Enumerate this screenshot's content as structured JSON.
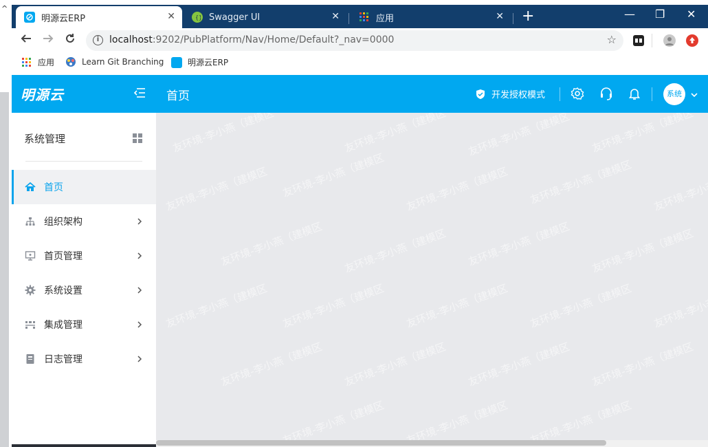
{
  "browser": {
    "tabs": [
      {
        "title": "明源云ERP",
        "close": "✕"
      },
      {
        "title": "Swagger UI",
        "close": "✕"
      },
      {
        "title": "应用",
        "close": "✕"
      }
    ],
    "new_tab": "+",
    "window_buttons": {
      "minimize": "—",
      "restore": "❐",
      "close": "✕"
    },
    "url_host": "localhost",
    "url_path": ":9202/PubPlatform/Nav/Home/Default?_nav=0000",
    "bookmarks": [
      "应用",
      "Learn Git Branching",
      "明源云ERP"
    ]
  },
  "header": {
    "logo": "明源云",
    "title": "首页",
    "mode_label": "开发授权模式",
    "avatar_text": "系统"
  },
  "sidebar": {
    "title": "系统管理",
    "items": [
      {
        "label": "首页",
        "icon": "home-icon",
        "active": true
      },
      {
        "label": "组织架构",
        "icon": "org-chart-icon"
      },
      {
        "label": "首页管理",
        "icon": "monitor-icon"
      },
      {
        "label": "系统设置",
        "icon": "gear-icon"
      },
      {
        "label": "集成管理",
        "icon": "integration-icon"
      },
      {
        "label": "日志管理",
        "icon": "log-book-icon"
      }
    ]
  },
  "watermark": {
    "text": "友环境-李小燕（建模区"
  },
  "colors": {
    "accent": "#01a8f0",
    "tabbar": "#123e6c",
    "content_bg": "#e8e9ec",
    "active_item": "#0ba4ec"
  }
}
